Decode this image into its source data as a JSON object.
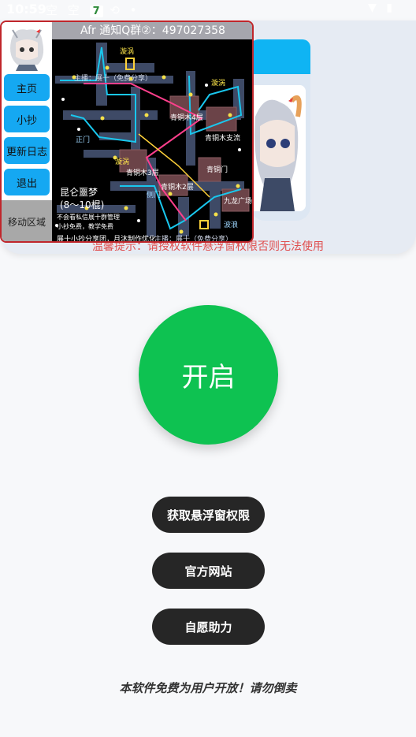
{
  "status_bar": {
    "time": "10:59",
    "icons": "空 空",
    "badge": "7",
    "extra": "⟲ •",
    "right_icons": "▼ ▮"
  },
  "overlay": {
    "title": "Afr 通知Q群②：497027358",
    "nav": {
      "home": "主页",
      "copy": "小抄",
      "changelog": "更新日志",
      "exit": "退出"
    },
    "move_area": "移动区域",
    "map": {
      "name": "昆仑噩梦",
      "range": "(8～10棍)",
      "note_line1": "不会看私信展十群管理",
      "note_line2": "小抄免费，教学免费",
      "credit": "展十小抄分享团，月沐制作优化",
      "labels": {
        "zhengmen": "正门",
        "cemen": "侧门",
        "xuanwo_top": "漩涡",
        "xuanwo_mid": "漩涡",
        "xuanwo_bottom": "漩涡",
        "bolang": "波浪",
        "qingtong_4f": "青铜木4层",
        "qingtong_3f": "青铜木3层",
        "qingtong_2f": "青铜木2层",
        "qingtong_men": "青铜门",
        "qingtong_zhiliu": "青铜木支流",
        "jiulong": "九龙广场",
        "zhubo_top": "主播：展十（免费分享）",
        "zhubo_bottom": "主播：展十（免费分享）"
      }
    }
  },
  "warning": "温馨提示：请授权软件悬浮窗权限否则无法使用",
  "start_button": "开启",
  "buttons": {
    "permission": "获取悬浮窗权限",
    "website": "官方网站",
    "donate": "自愿助力"
  },
  "footer": "本软件免费为用户开放！请勿倒卖",
  "colors": {
    "accent_blue": "#15a8f2",
    "start_green": "#0ec251",
    "pill_dark": "#262626",
    "warning_red": "#e05050"
  }
}
